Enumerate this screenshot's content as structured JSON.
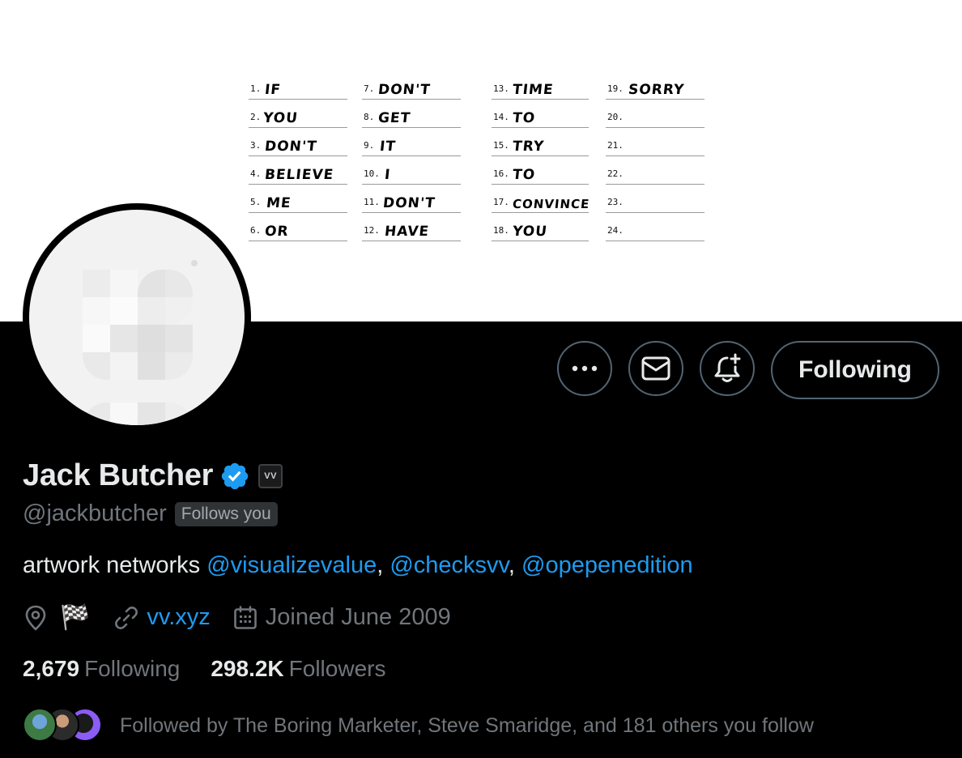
{
  "banner": {
    "columns": [
      [
        {
          "num": "1.",
          "word": "IF"
        },
        {
          "num": "2.",
          "word": "YOU"
        },
        {
          "num": "3.",
          "word": "DON'T"
        },
        {
          "num": "4.",
          "word": "BELIEVE"
        },
        {
          "num": "5.",
          "word": "ME"
        },
        {
          "num": "6.",
          "word": "OR"
        }
      ],
      [
        {
          "num": "7.",
          "word": "DON'T"
        },
        {
          "num": "8.",
          "word": "GET"
        },
        {
          "num": "9.",
          "word": "IT"
        },
        {
          "num": "10.",
          "word": "I"
        },
        {
          "num": "11.",
          "word": "DON'T"
        },
        {
          "num": "12.",
          "word": "HAVE"
        }
      ],
      [
        {
          "num": "13.",
          "word": "TIME"
        },
        {
          "num": "14.",
          "word": "TO"
        },
        {
          "num": "15.",
          "word": "TRY"
        },
        {
          "num": "16.",
          "word": "TO"
        },
        {
          "num": "17.",
          "word": "CONVINCE"
        },
        {
          "num": "18.",
          "word": "YOU"
        }
      ],
      [
        {
          "num": "19.",
          "word": "SORRY"
        },
        {
          "num": "20.",
          "word": ""
        },
        {
          "num": "21.",
          "word": ""
        },
        {
          "num": "22.",
          "word": ""
        },
        {
          "num": "23.",
          "word": ""
        },
        {
          "num": "24.",
          "word": ""
        }
      ]
    ]
  },
  "actions": {
    "more_icon": "more-horizontal-icon",
    "message_icon": "mail-icon",
    "notify_icon": "bell-plus-icon",
    "follow_label": "Following"
  },
  "profile": {
    "name": "Jack Butcher",
    "affiliate_badge": "VV",
    "handle": "@jackbutcher",
    "follows_you": "Follows you",
    "bio": {
      "text": "artwork networks",
      "mentions": [
        "@visualizevalue",
        "@checksvv",
        "@opepenedition"
      ],
      "separator": ","
    },
    "location_icon": "location-pin-icon",
    "location_flag": "🏁",
    "website": "vv.xyz",
    "joined": "Joined June 2009"
  },
  "stats": {
    "following_count": "2,679",
    "following_label": "Following",
    "followers_count": "298.2K",
    "followers_label": "Followers"
  },
  "followed_by": "Followed by The Boring Marketer, Steve Smaridge, and 181 others you follow",
  "colors": {
    "accent": "#1d9bf0",
    "muted": "#71767b",
    "border": "#536471",
    "background": "#000000"
  }
}
